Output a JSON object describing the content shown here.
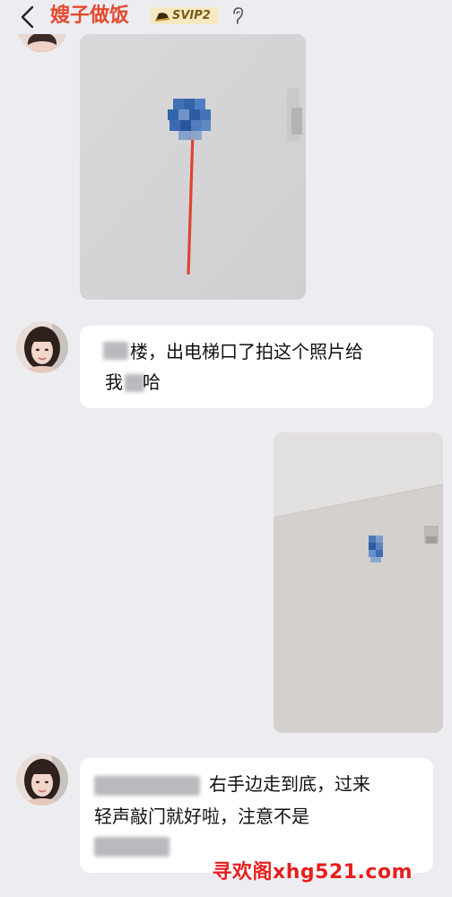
{
  "header": {
    "title": "嫂子做饭",
    "vip_label": "SVIP2",
    "back_icon": "chevron-left-icon",
    "audio_icon": "ear-icon"
  },
  "messages": [
    {
      "from": "other",
      "type": "image",
      "description_icon": "photo"
    },
    {
      "from": "other",
      "type": "text",
      "line1": "楼，出电梯口了拍这个照片给",
      "line2_prefix": "我",
      "line2_suffix": "哈"
    },
    {
      "from": "me",
      "type": "image"
    },
    {
      "from": "other",
      "type": "text",
      "line1": "右手边走到底，过来",
      "line2": "轻声敲门就好啦，注意不是"
    }
  ],
  "watermark": "寻欢阁xhg521.com",
  "colors": {
    "title": "#e4492f",
    "bg": "#ededf1",
    "bubble": "#ffffff",
    "watermark": "#e61e1e"
  }
}
